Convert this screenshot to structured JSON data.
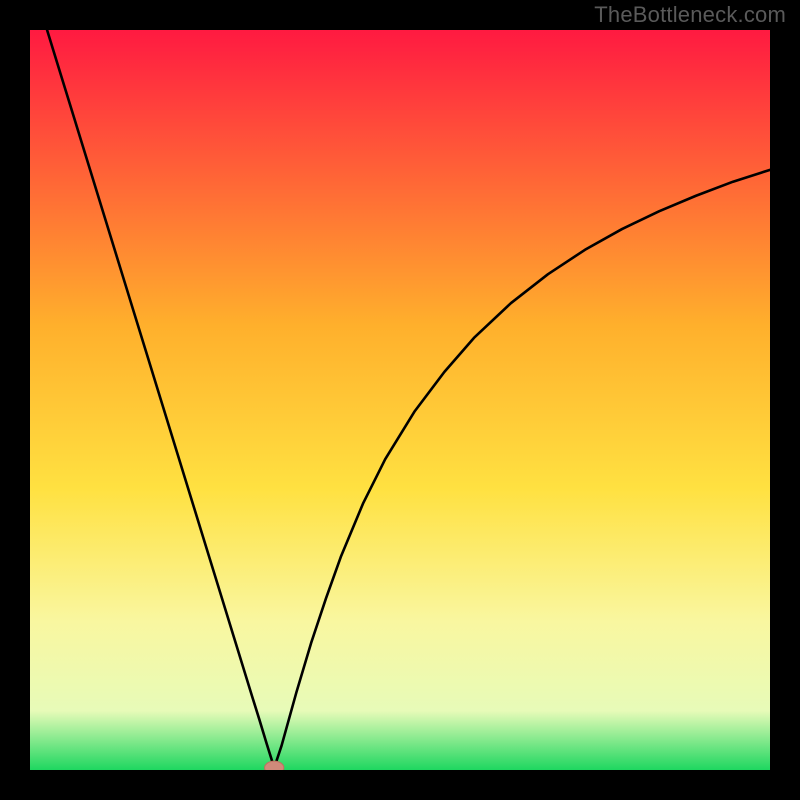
{
  "watermark": "TheBottleneck.com",
  "colors": {
    "curve_stroke": "#000000",
    "marker_fill": "#d08a7a",
    "marker_stroke": "#c07060",
    "background_top": "#ff1a41",
    "background_mid1": "#ffb02c",
    "background_mid2": "#ffe141",
    "background_mid3": "#f9f7a0",
    "background_low": "#e7fbb8",
    "background_bottom": "#1ed760"
  },
  "chart_data": {
    "type": "line",
    "title": "",
    "xlabel": "",
    "ylabel": "",
    "xlim": [
      0,
      100
    ],
    "ylim": [
      0,
      100
    ],
    "x_min_point": 33,
    "series": [
      {
        "name": "bottleneck_curve",
        "x": [
          0,
          2,
          4,
          6,
          8,
          10,
          12,
          14,
          16,
          18,
          20,
          22,
          24,
          26,
          28,
          30,
          31,
          32,
          33,
          34,
          36,
          38,
          40,
          42,
          45,
          48,
          52,
          56,
          60,
          65,
          70,
          75,
          80,
          85,
          90,
          95,
          100
        ],
        "values": [
          108,
          101,
          94.5,
          88,
          81.5,
          75,
          68.5,
          62,
          55.5,
          49,
          42.5,
          36,
          29.5,
          23,
          16.5,
          10,
          6.8,
          3.5,
          0.3,
          3.3,
          10.5,
          17.2,
          23.2,
          28.8,
          36,
          42,
          48.5,
          53.8,
          58.4,
          63.1,
          67,
          70.3,
          73.1,
          75.5,
          77.6,
          79.5,
          81.1
        ]
      }
    ],
    "marker": {
      "x": 33,
      "y": 0.3,
      "rx": 1.3,
      "ry": 0.9
    },
    "gradient_stops": [
      {
        "offset": 0.0,
        "key": "background_top"
      },
      {
        "offset": 0.4,
        "key": "background_mid1"
      },
      {
        "offset": 0.62,
        "key": "background_mid2"
      },
      {
        "offset": 0.8,
        "key": "background_mid3"
      },
      {
        "offset": 0.92,
        "key": "background_low"
      },
      {
        "offset": 1.0,
        "key": "background_bottom"
      }
    ]
  }
}
